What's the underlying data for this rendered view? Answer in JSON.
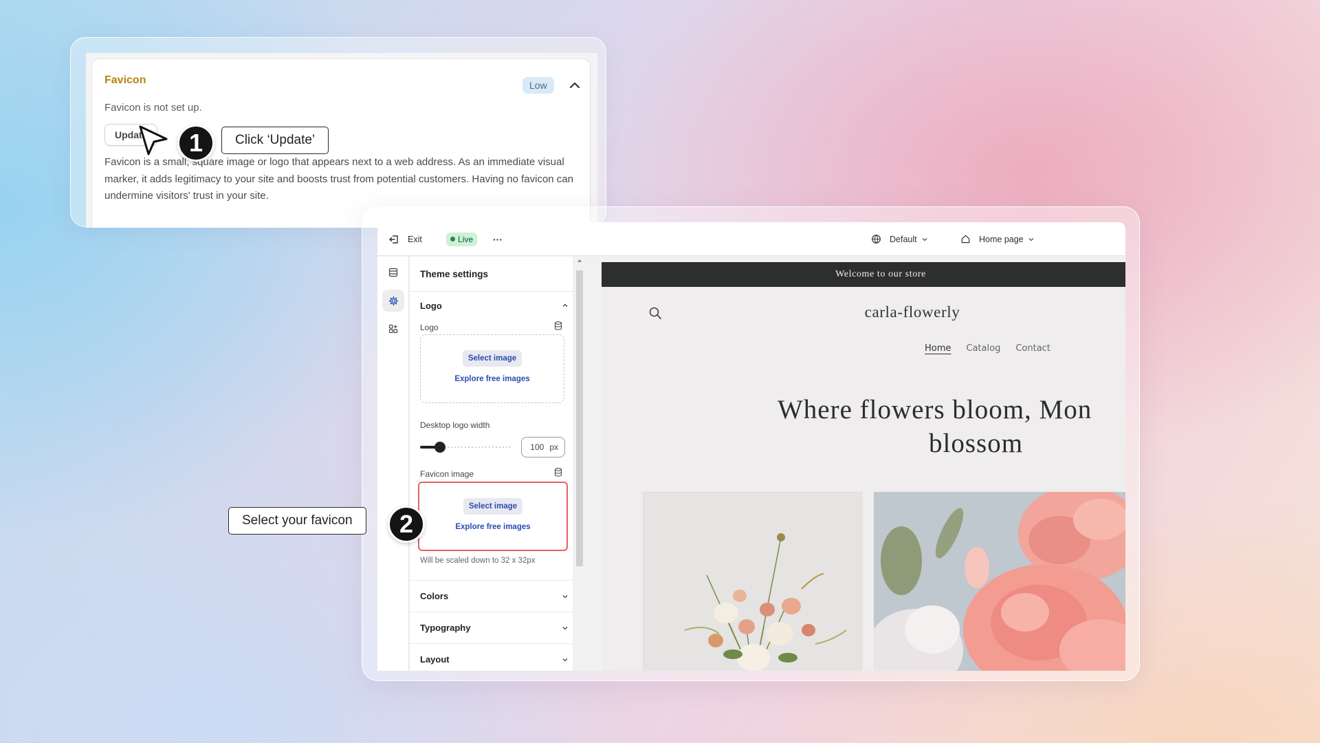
{
  "issue_card": {
    "title": "Favicon",
    "badge": "Low",
    "status": "Favicon is not set up.",
    "update_label": "Update",
    "body": "Favicon is a small, square image or logo that appears next to a web address. As an immediate visual marker, it adds legitimacy to your site and boosts trust from potential customers. Having no favicon can undermine visitors' trust in your site."
  },
  "steps": [
    {
      "number": "1",
      "callout": "Click ‘Update’"
    },
    {
      "number": "2",
      "callout": "Select your favicon"
    }
  ],
  "topbar": {
    "exit_label": "Exit",
    "live_label": "Live",
    "more_label": "···",
    "theme_select": "Default",
    "page_select": "Home page"
  },
  "panel": {
    "title": "Theme settings",
    "logo_section": "Logo",
    "logo_field": "Logo",
    "select_image": "Select image",
    "explore_images": "Explore free images",
    "width_label": "Desktop logo width",
    "width_value": "100",
    "width_unit": "px",
    "width_slider_fraction": 0.22,
    "favicon_field": "Favicon image",
    "favicon_hint": "Will be scaled down to 32 x 32px",
    "collapsed_sections": [
      "Colors",
      "Typography",
      "Layout"
    ]
  },
  "store": {
    "announcement": "Welcome to our store",
    "name": "carla-flowerly",
    "nav": [
      "Home",
      "Catalog",
      "Contact"
    ],
    "hero_line1": "Where flowers bloom, Mon",
    "hero_line2": "blossom"
  },
  "colors": {
    "accent_blue": "#2c4bb0",
    "highlight_red": "#e86060",
    "favicon_title": "#b88310",
    "live_green": "#29845a"
  }
}
